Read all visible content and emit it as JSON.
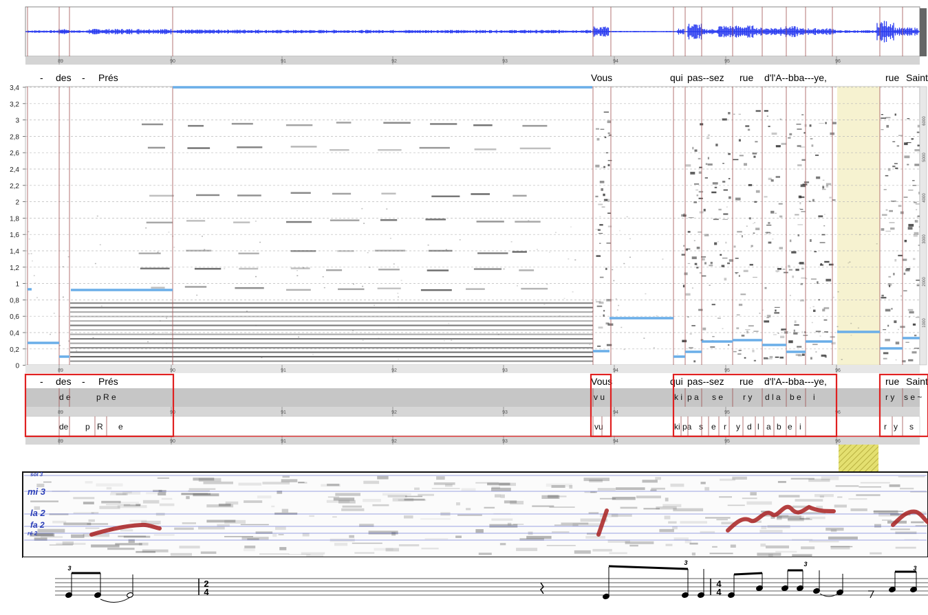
{
  "timeline_ticks": [
    "89",
    "90",
    "91",
    "92",
    "93",
    "94",
    "95",
    "96"
  ],
  "lyrics": {
    "words_top": [
      "-",
      "des",
      "-",
      "Prés",
      "Vous",
      "qui",
      "pas--sez",
      "rue",
      "d'l'A--bba---ye,",
      "rue",
      "Saint"
    ],
    "words_lower": [
      "-",
      "des",
      "-",
      "Prés",
      "Vous",
      "qui",
      "pas--sez",
      "rue",
      "d'l'A--bba---ye,",
      "rue",
      "Saint"
    ]
  },
  "phonetics": {
    "row1": [
      "de",
      "pRe",
      "vu",
      "ki",
      "pa",
      "se",
      "ry",
      "dla",
      "be",
      "i",
      "ry",
      "se~"
    ],
    "row2": [
      "de",
      "p",
      "R",
      "e",
      "vu",
      "ki",
      "pa",
      "s",
      "e",
      "r",
      "y",
      "d",
      "l",
      "a",
      "b",
      "e",
      "i",
      "r",
      "y",
      "s"
    ]
  },
  "y_axis": {
    "labels": [
      "3,4",
      "3,2",
      "3",
      "2,8",
      "2,6",
      "2,4",
      "2,2",
      "2",
      "1,8",
      "1,6",
      "1,4",
      "1,2",
      "1",
      "0,8",
      "0,6",
      "0,4",
      "0,2",
      "0"
    ],
    "right_labels": [
      "6000",
      "5000",
      "4000",
      "3000",
      "2000",
      "1000"
    ]
  },
  "pitch_labels": [
    "sol 3",
    "mi 3",
    "la 2",
    "fa 2",
    "ré 2"
  ],
  "notation": {
    "triplet_marks": [
      "3",
      "3",
      "3",
      "3"
    ],
    "time_signatures": [
      {
        "top": "2",
        "bottom": "4"
      },
      {
        "top": "4",
        "bottom": "4"
      }
    ]
  },
  "colors": {
    "waveform": "#2a3cf0",
    "pitch_line": "#6aaee8",
    "segment_box": "#e02020",
    "highlight": "#f5f0c0",
    "pitch_label": "#2b3fb8",
    "melody": "#a82020"
  }
}
